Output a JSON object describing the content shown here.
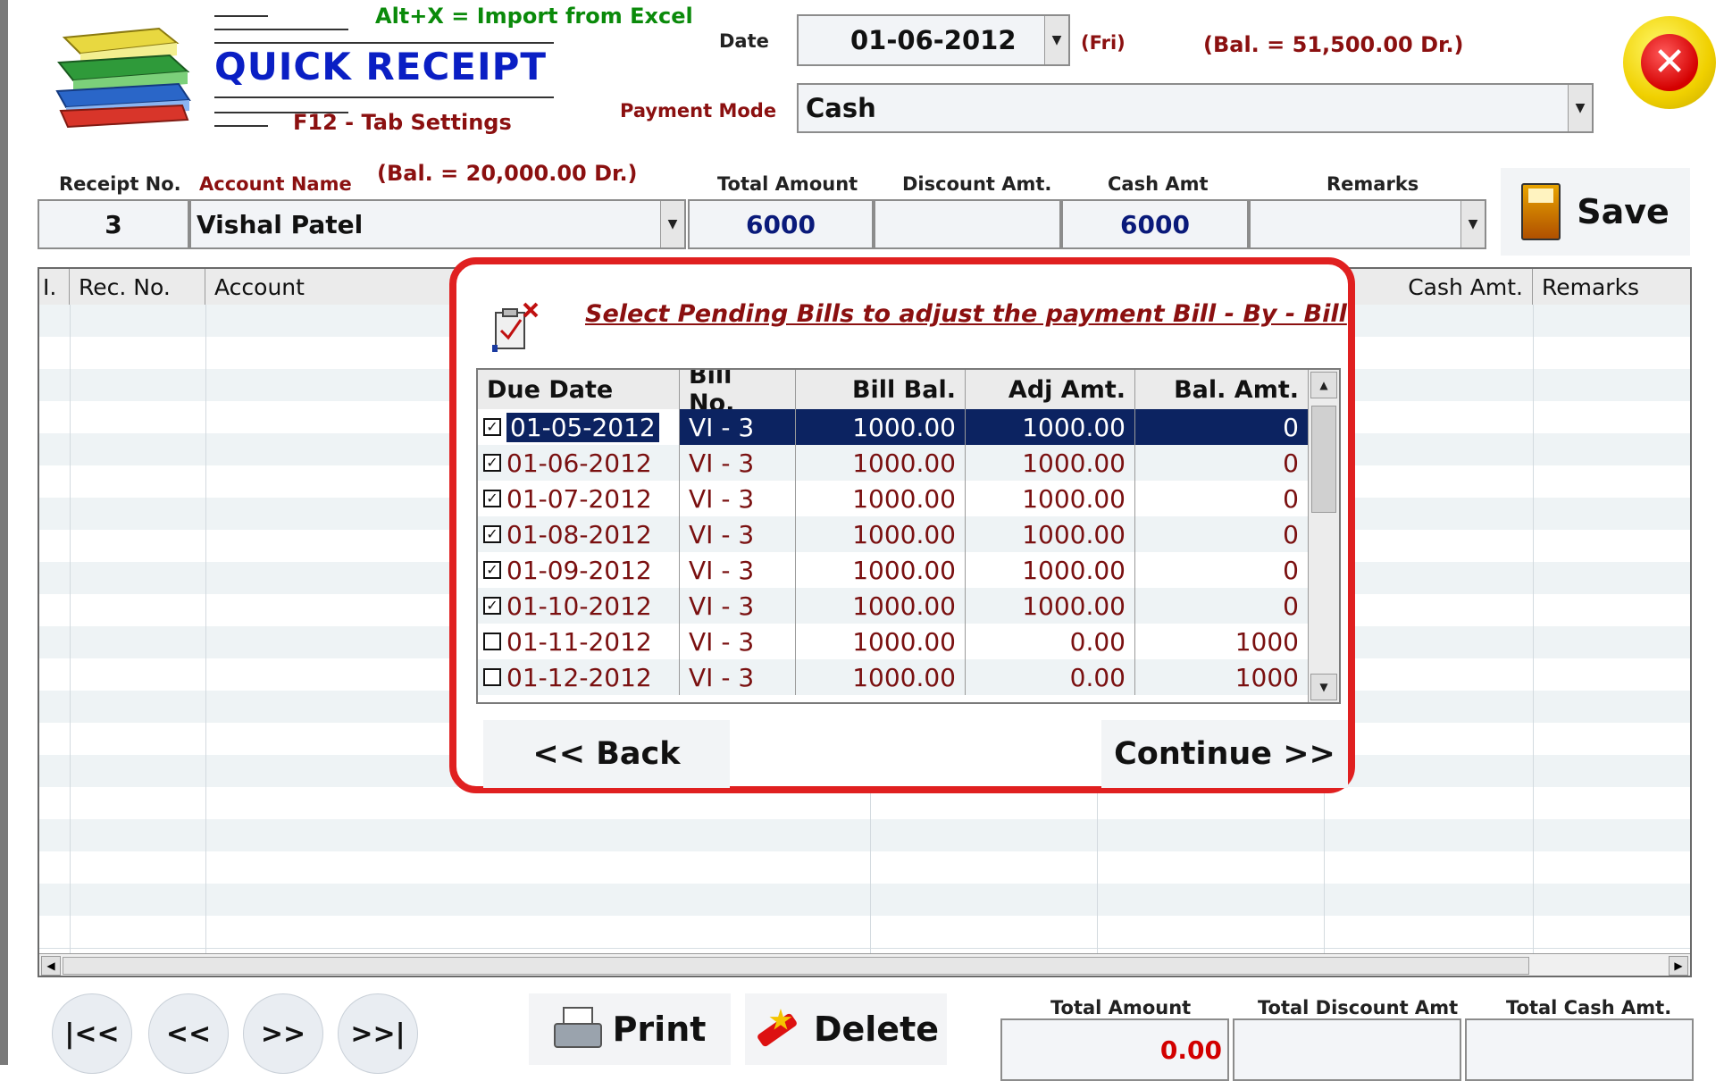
{
  "header": {
    "title": "QUICK RECEIPT",
    "import_hint": "Alt+X =  Import from Excel",
    "settings_hint": "F12 - Tab Settings",
    "date_label": "Date",
    "date_value": "01-06-2012",
    "day": "(Fri)",
    "top_balance": "(Bal. =  51,500.00 Dr.)",
    "payment_mode_label": "Payment Mode",
    "payment_mode_value": "Cash"
  },
  "entry": {
    "receipt_no_label": "Receipt No.",
    "receipt_no_value": "3",
    "account_name_label": "Account Name",
    "account_balance": "(Bal. =  20,000.00 Dr.)",
    "account_value": "Vishal Patel",
    "total_amount_label": "Total Amount",
    "total_amount_value": "6000",
    "discount_label": "Discount Amt.",
    "discount_value": "",
    "cash_amt_label": "Cash Amt",
    "cash_amt_value": "6000",
    "remarks_label": "Remarks",
    "remarks_value": "",
    "save_label": "Save"
  },
  "grid": {
    "columns": [
      "I.",
      "Rec. No.",
      "Account",
      "Cash Amt.",
      "Remarks"
    ]
  },
  "modal": {
    "title": "Select Pending Bills to adjust the payment Bill - By - Bill",
    "columns": [
      "Due Date",
      "Bill No.",
      "Bill Bal.",
      "Adj Amt.",
      "Bal. Amt."
    ],
    "rows": [
      {
        "checked": true,
        "due_date": "01-05-2012",
        "bill_no": "VI - 3",
        "bill_bal": "1000.00",
        "adj_amt": "1000.00",
        "bal_amt": "0"
      },
      {
        "checked": true,
        "due_date": "01-06-2012",
        "bill_no": "VI - 3",
        "bill_bal": "1000.00",
        "adj_amt": "1000.00",
        "bal_amt": "0"
      },
      {
        "checked": true,
        "due_date": "01-07-2012",
        "bill_no": "VI - 3",
        "bill_bal": "1000.00",
        "adj_amt": "1000.00",
        "bal_amt": "0"
      },
      {
        "checked": true,
        "due_date": "01-08-2012",
        "bill_no": "VI - 3",
        "bill_bal": "1000.00",
        "adj_amt": "1000.00",
        "bal_amt": "0"
      },
      {
        "checked": true,
        "due_date": "01-09-2012",
        "bill_no": "VI - 3",
        "bill_bal": "1000.00",
        "adj_amt": "1000.00",
        "bal_amt": "0"
      },
      {
        "checked": true,
        "due_date": "01-10-2012",
        "bill_no": "VI - 3",
        "bill_bal": "1000.00",
        "adj_amt": "1000.00",
        "bal_amt": "0"
      },
      {
        "checked": false,
        "due_date": "01-11-2012",
        "bill_no": "VI - 3",
        "bill_bal": "1000.00",
        "adj_amt": "0.00",
        "bal_amt": "1000"
      },
      {
        "checked": false,
        "due_date": "01-12-2012",
        "bill_no": "VI - 3",
        "bill_bal": "1000.00",
        "adj_amt": "0.00",
        "bal_amt": "1000"
      }
    ],
    "selected_row": 0,
    "back_label": "<< Back",
    "continue_label": "Continue >>"
  },
  "navigation": {
    "first": "|<<",
    "prev": "<<",
    "next": ">>",
    "last": ">>|"
  },
  "actions": {
    "print_label": "Print",
    "delete_label": "Delete"
  },
  "totals": {
    "total_amount_label": "Total Amount",
    "total_amount_value": "0.00",
    "total_discount_label": "Total Discount Amt",
    "total_discount_value": "",
    "total_cash_label": "Total Cash Amt.",
    "total_cash_value": ""
  },
  "icons": {
    "logo": "books-stack-icon",
    "close": "close-icon",
    "save": "floppy-disk-icon",
    "print": "printer-icon",
    "delete": "eraser-icon",
    "modal": "checklist-icon"
  },
  "colors": {
    "title_blue": "#0a1fc4",
    "hint_green": "#0a8a0a",
    "label_red": "#8b1010",
    "modal_border": "#e02020",
    "selected_row": "#0c2361",
    "total_red": "#d20000"
  }
}
